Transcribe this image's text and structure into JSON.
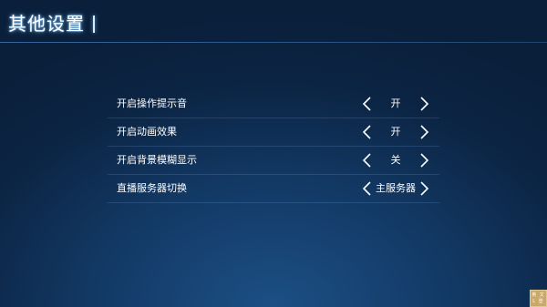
{
  "header": {
    "title": "其他设置"
  },
  "settings": [
    {
      "label": "开启操作提示音",
      "value": "开"
    },
    {
      "label": "开启动画效果",
      "value": "开"
    },
    {
      "label": "开启背景模糊显示",
      "value": "关"
    },
    {
      "label": "直播服务器切换",
      "value": "主服务器"
    }
  ],
  "icons": {
    "prev": "chevron-left-icon",
    "next": "chevron-right-icon"
  },
  "colors": {
    "background": "#0c2545",
    "title_glow": "#78beff",
    "badge": "#c9a86b"
  },
  "corner_badge": {
    "text": "英 文 L 登"
  }
}
